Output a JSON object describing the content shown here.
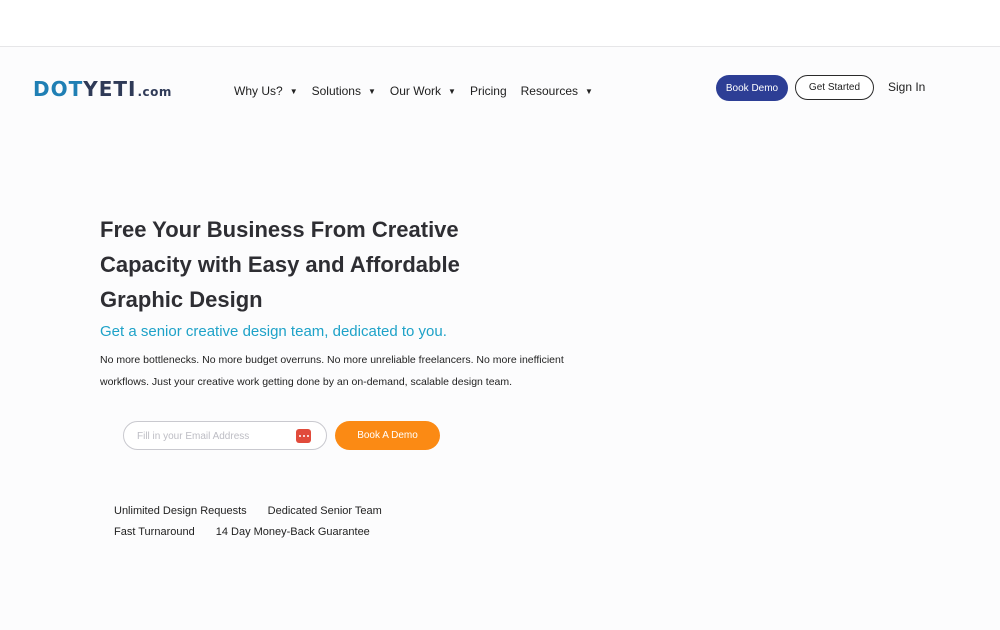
{
  "logo": {
    "brand_part1": "DOT",
    "brand_part2": "YETI",
    "tld": ".com"
  },
  "nav": {
    "items": [
      {
        "label": "Why Us?",
        "has_dropdown": true
      },
      {
        "label": "Solutions",
        "has_dropdown": true
      },
      {
        "label": "Our Work",
        "has_dropdown": true
      },
      {
        "label": "Pricing",
        "has_dropdown": false
      },
      {
        "label": "Resources",
        "has_dropdown": true
      }
    ],
    "caret_glyph": "▼"
  },
  "header_actions": {
    "book_demo": "Book Demo",
    "get_started": "Get Started",
    "sign_in": "Sign In"
  },
  "hero": {
    "title_line1": "Free Your Business From Creative",
    "title_line2": "Capacity with Easy and Affordable",
    "title_line3": "Graphic Design",
    "subtitle": "Get a senior creative design team, dedicated to you.",
    "description": "No more bottlenecks. No more budget overruns. No more unreliable freelancers. No more inefficient workflows. Just your creative work getting done by an on-demand, scalable design team."
  },
  "signup_form": {
    "email_placeholder": "Fill in your Email Address",
    "email_value": "",
    "submit_label": "Book A Demo",
    "field_icon": "password-manager-icon"
  },
  "features": {
    "row1": [
      "Unlimited Design Requests",
      "Dedicated Senior Team"
    ],
    "row2": [
      "Fast Turnaround",
      "14 Day Money-Back Guarantee"
    ]
  },
  "colors": {
    "primary_button": "#2d3e95",
    "accent_orange": "#fb8a14",
    "subtitle_blue": "#1ea2c8",
    "logo_blue": "#1f7fb4",
    "field_icon_red": "#e14b3b"
  }
}
